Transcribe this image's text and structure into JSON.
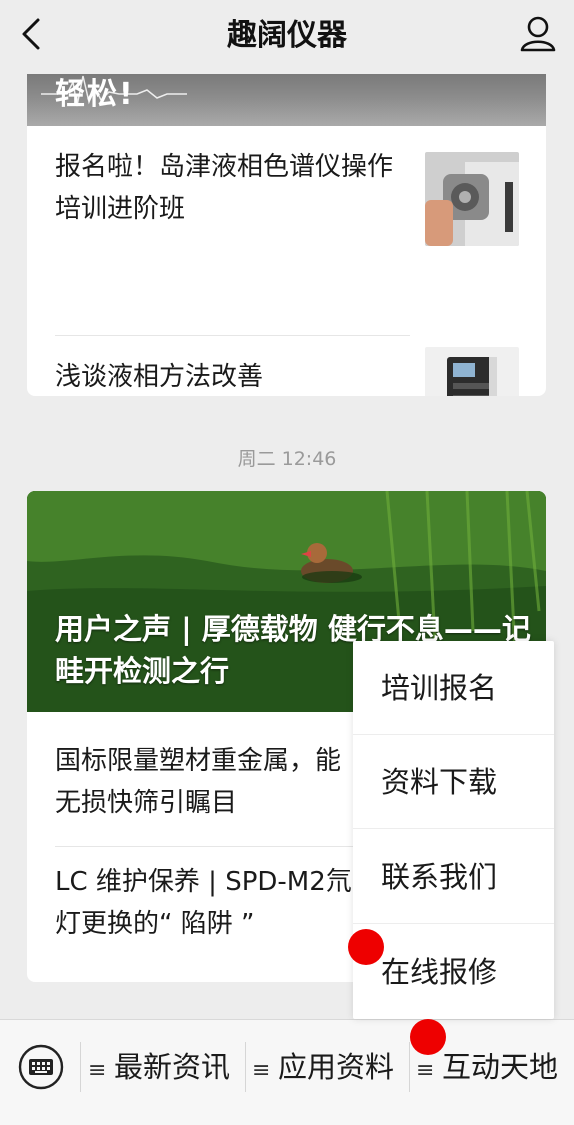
{
  "header": {
    "title": "趣阔仪器",
    "back_icon": "chevron-left-icon",
    "profile_icon": "user-icon"
  },
  "card1": {
    "hero_title": "轻松!",
    "articles": [
      {
        "title": "报名啦！岛津液相色谱仪操作培训进阶班"
      },
      {
        "title": "浅谈液相方法改善"
      }
    ]
  },
  "timestamp": "周二 12:46",
  "card2": {
    "hero_title": "用户之声 | 厚德载物 健行不息——记畦开检测之行",
    "articles": [
      {
        "title": "国标限量塑材重金属，能无损快筛引瞩目"
      },
      {
        "title": "LC 维护保养 | SPD-M2氘灯更换的“ 陷阱 ”"
      }
    ]
  },
  "popup_menu": {
    "items": [
      "培训报名",
      "资料下载",
      "联系我们",
      "在线报修"
    ]
  },
  "bottom_menu": {
    "keyboard_icon": "keyboard-icon",
    "items": [
      "最新资讯",
      "应用资料",
      "互动天地"
    ],
    "menu_icon": "≡"
  },
  "colors": {
    "background": "#ededed",
    "card": "#ffffff",
    "marker": "#ee0000",
    "timestamp": "#9a9a9a"
  }
}
